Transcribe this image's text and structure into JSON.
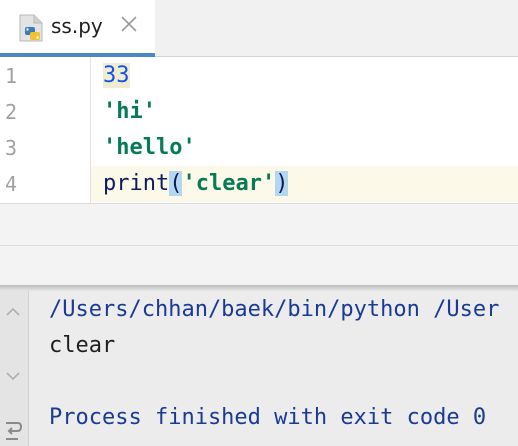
{
  "tab": {
    "filename": "ss.py",
    "icon": "python-file-icon"
  },
  "editor": {
    "line_numbers": [
      "1",
      "2",
      "3",
      "4"
    ],
    "lines": {
      "l1": "33",
      "l2": "'hi'",
      "l3": "'hello'",
      "l4": {
        "fn": "print",
        "open": "(",
        "arg": "'clear'",
        "close": ")"
      }
    }
  },
  "console": {
    "command": "/Users/chhan/baek/bin/python /User",
    "output": "clear",
    "exit": "Process finished with exit code 0"
  },
  "colors": {
    "accent": "#4a88c7",
    "number": "#1750eb",
    "string": "#077a56",
    "console_text": "#1a3a96"
  }
}
